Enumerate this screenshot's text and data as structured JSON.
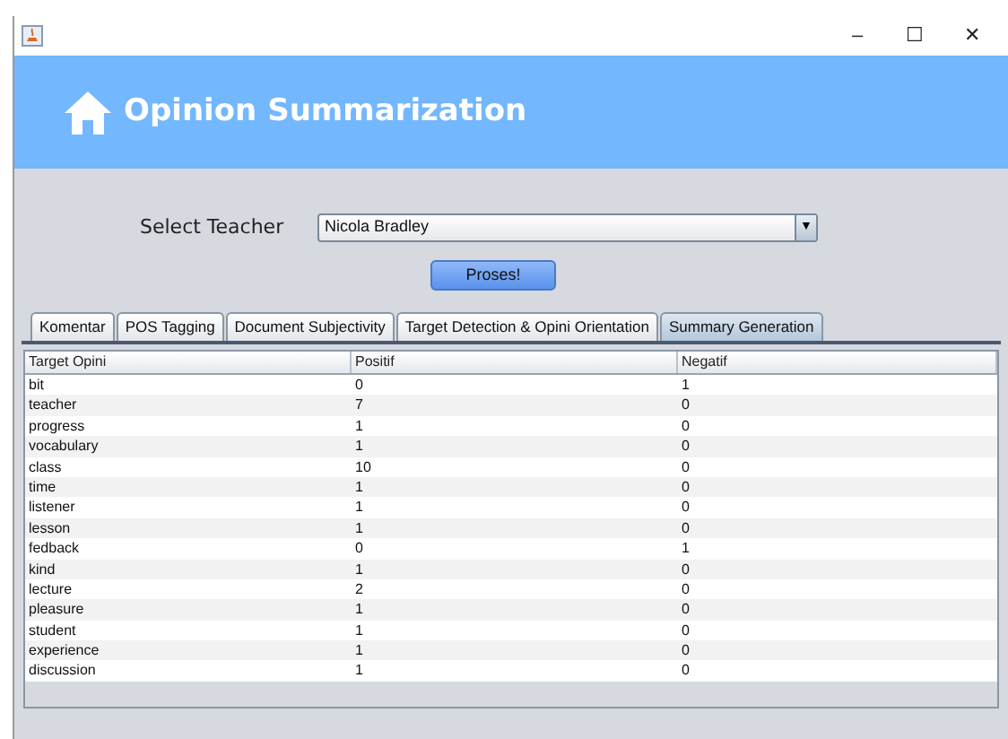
{
  "window": {
    "title_controls": [
      "–",
      "☐",
      "✕"
    ]
  },
  "header": {
    "title": "Opinion Summarization"
  },
  "teacher_select": {
    "label": "Select Teacher",
    "value": "Nicola Bradley",
    "arrow": "▼"
  },
  "process_button": "Proses!",
  "tabs": [
    {
      "label": "Komentar",
      "selected": false
    },
    {
      "label": "POS Tagging",
      "selected": false
    },
    {
      "label": "Document Subjectivity",
      "selected": false
    },
    {
      "label": "Target Detection & Opini Orientation",
      "selected": false
    },
    {
      "label": "Summary Generation",
      "selected": true
    }
  ],
  "table": {
    "columns": [
      "Target Opini",
      "Positif",
      "Negatif"
    ],
    "rows": [
      [
        "bit",
        "0",
        "1"
      ],
      [
        "teacher",
        "7",
        "0"
      ],
      [
        "progress",
        "1",
        "0"
      ],
      [
        "vocabulary",
        "1",
        "0"
      ],
      [
        "class",
        "10",
        "0"
      ],
      [
        "time",
        "1",
        "0"
      ],
      [
        "listener",
        "1",
        "0"
      ],
      [
        "lesson",
        "1",
        "0"
      ],
      [
        "fedback",
        "0",
        "1"
      ],
      [
        "kind",
        "1",
        "0"
      ],
      [
        "lecture",
        "2",
        "0"
      ],
      [
        "pleasure",
        "1",
        "0"
      ],
      [
        "student",
        "1",
        "0"
      ],
      [
        "experience",
        "1",
        "0"
      ],
      [
        "discussion",
        "1",
        "0"
      ]
    ]
  }
}
